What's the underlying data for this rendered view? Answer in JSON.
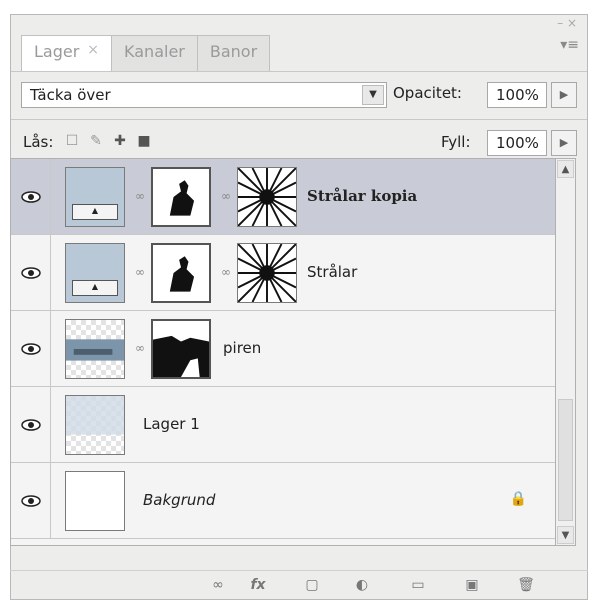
{
  "tabs": [
    {
      "label": "Lager",
      "active": true,
      "close": "×"
    },
    {
      "label": "Kanaler",
      "active": false
    },
    {
      "label": "Banor",
      "active": false
    }
  ],
  "blend": {
    "mode": "Täcka över",
    "opacity_label": "Opacitet:",
    "opacity_value": "100%"
  },
  "lock": {
    "label": "Lås:",
    "fill_label": "Fyll:",
    "fill_value": "100%"
  },
  "layers": [
    {
      "name": "Strålar kopia",
      "selected": true
    },
    {
      "name": "Strålar",
      "selected": false
    },
    {
      "name": "piren",
      "selected": false
    },
    {
      "name": "Lager 1",
      "selected": false
    },
    {
      "name": "Bakgrund",
      "selected": false,
      "locked": true
    }
  ],
  "bottom_icons": [
    "link-icon",
    "fx-icon",
    "mask-icon",
    "adjustment-icon",
    "group-icon",
    "new-layer-icon",
    "trash-icon"
  ],
  "colors": {
    "selected_row": "#c9cbd6",
    "panel_bg": "#ededec"
  }
}
